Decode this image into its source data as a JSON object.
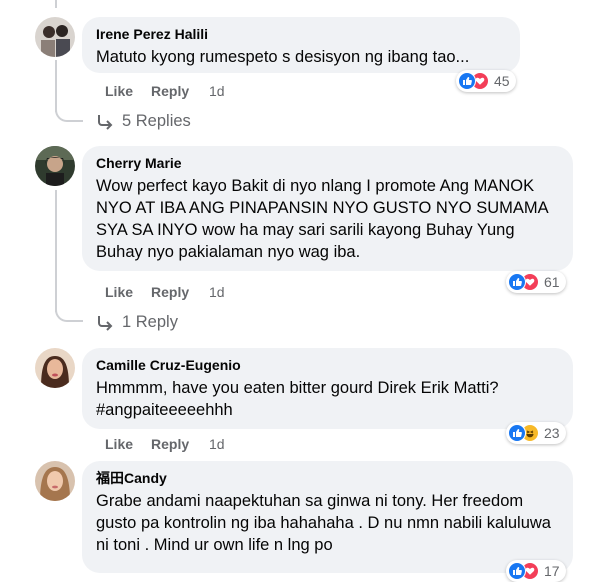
{
  "comments": [
    {
      "author": "Irene Perez Halili",
      "text": "Matuto kyong rumespeto s desisyon ng ibang tao...",
      "reaction_count": "45",
      "reactions": [
        "like",
        "love"
      ],
      "like_label": "Like",
      "reply_label": "Reply",
      "time": "1d",
      "replies_label": "5 Replies"
    },
    {
      "author": "Cherry Marie",
      "text": "Wow perfect kayo Bakit di nyo nlang I promote Ang MANOK NYO AT IBA ANG PINAPANSIN NYO GUSTO NYO SUMAMA SYA SA INYO wow ha may sari sarili kayong Buhay Yung Buhay nyo pakialaman nyo wag iba.",
      "reaction_count": "61",
      "reactions": [
        "like",
        "love"
      ],
      "like_label": "Like",
      "reply_label": "Reply",
      "time": "1d",
      "replies_label": "1 Reply"
    },
    {
      "author": "Camille Cruz-Eugenio",
      "text": "Hmmmm, have you eaten bitter gourd Direk Erik Matti? #angpaiteeeeehhh",
      "reaction_count": "23",
      "reactions": [
        "like",
        "haha"
      ],
      "like_label": "Like",
      "reply_label": "Reply",
      "time": "1d"
    },
    {
      "author": "福田Candy",
      "text": "Grabe andami naapektuhan sa ginwa ni tony. Her freedom gusto pa kontrolin ng iba hahahaha . D nu nmn nabili kaluluwa ni toni . Mind ur own life n lng po",
      "reaction_count": "17",
      "reactions": [
        "like",
        "love"
      ]
    }
  ],
  "colors": {
    "bubble": "#f0f2f5",
    "secondary_text": "#65676b",
    "like_blue": "#1877f2",
    "love_red": "#f33e58",
    "haha_yellow": "#f7b928"
  }
}
